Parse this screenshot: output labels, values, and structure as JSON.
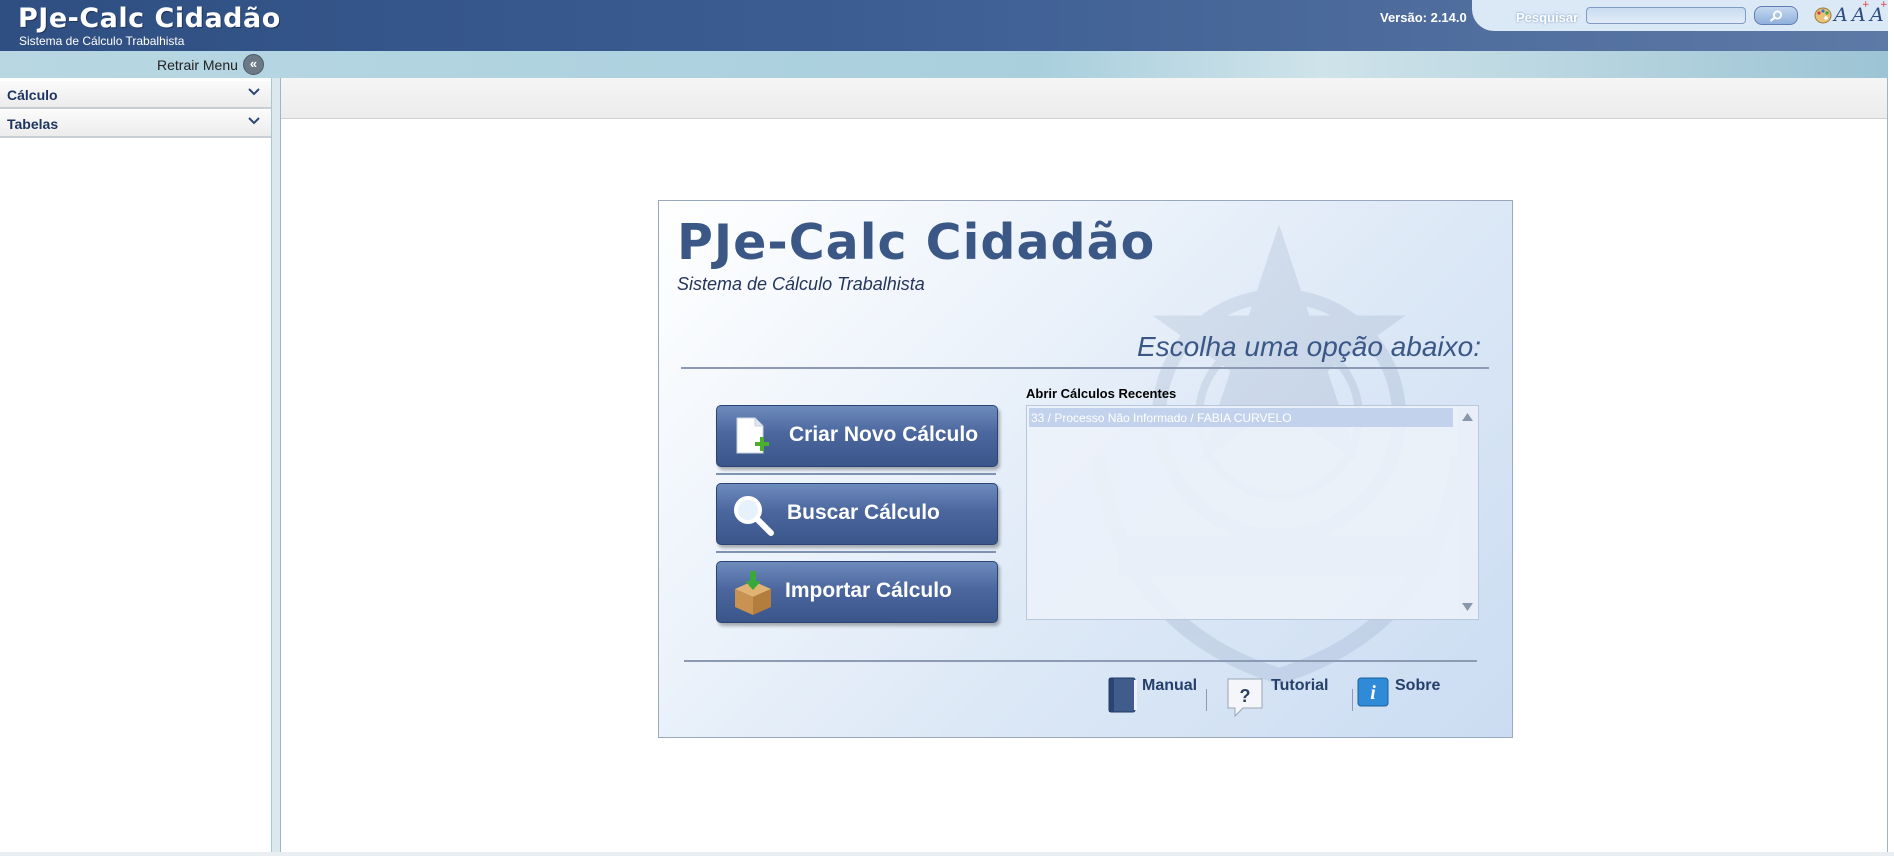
{
  "header": {
    "title": "PJe-Calc Cidadão",
    "subtitle": "Sistema de Cálculo Trabalhista",
    "version": "Versão: 2.14.0",
    "search_label": "Pesquisar",
    "search_value": "",
    "icons": [
      "palette-icon",
      "font-normal-icon",
      "font-increase-icon",
      "font-decrease-icon"
    ]
  },
  "toolbar": {
    "retract_label": "Retrair Menu",
    "retract_icon": "double-chevron-left-icon"
  },
  "sidebar": {
    "items": [
      {
        "label": "Cálculo",
        "icon": "chevron-down-icon"
      },
      {
        "label": "Tabelas",
        "icon": "chevron-down-icon"
      }
    ]
  },
  "panel": {
    "title": "PJe-Calc Cidadão",
    "subtitle": "Sistema de Cálculo Trabalhista",
    "prompt": "Escolha uma opção abaixo:",
    "actions": [
      {
        "label": "Criar Novo Cálculo",
        "icon": "new-document-icon"
      },
      {
        "label": "Buscar Cálculo",
        "icon": "magnifier-icon"
      },
      {
        "label": "Importar Cálculo",
        "icon": "import-box-icon"
      }
    ],
    "recent": {
      "title": "Abrir Cálculos Recentes",
      "items": [
        "33 / Processo Não Informado / FABIA CURVELO"
      ]
    },
    "links": [
      {
        "label": "Manual",
        "icon": "book-icon"
      },
      {
        "label": "Tutorial",
        "icon": "question-icon"
      },
      {
        "label": "Sobre",
        "icon": "info-icon"
      }
    ]
  },
  "colors": {
    "header_bg": "#2f4f82",
    "panel_title": "#3a5786",
    "button_bg": "#4b679e",
    "strip_bg": "#b8d7e3"
  }
}
